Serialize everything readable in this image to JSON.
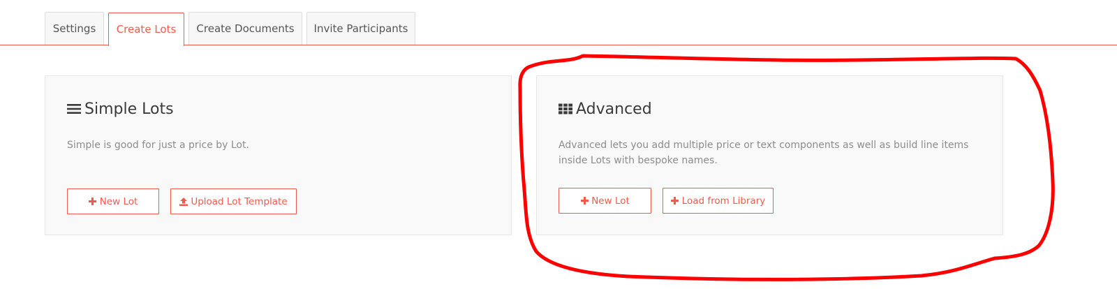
{
  "tabs": [
    {
      "label": "Settings",
      "active": false
    },
    {
      "label": "Create Lots",
      "active": true
    },
    {
      "label": "Create Documents",
      "active": false
    },
    {
      "label": "Invite Participants",
      "active": false
    }
  ],
  "simple": {
    "icon": "list-icon",
    "title": "Simple Lots",
    "description": "Simple is good for just a price by Lot.",
    "new_lot_label": "New Lot",
    "upload_label": "Upload Lot Template"
  },
  "advanced": {
    "icon": "grid-icon",
    "title": "Advanced",
    "description": "Advanced lets you add multiple price or text components as well as build line items inside Lots with bespoke names.",
    "new_lot_label": "New Lot",
    "library_label": "Load from Library"
  },
  "colors": {
    "accent": "#f05a4a",
    "annotation": "#ff0000",
    "panel_bg": "#f9f9f9",
    "muted_text": "#8c8c8c"
  }
}
